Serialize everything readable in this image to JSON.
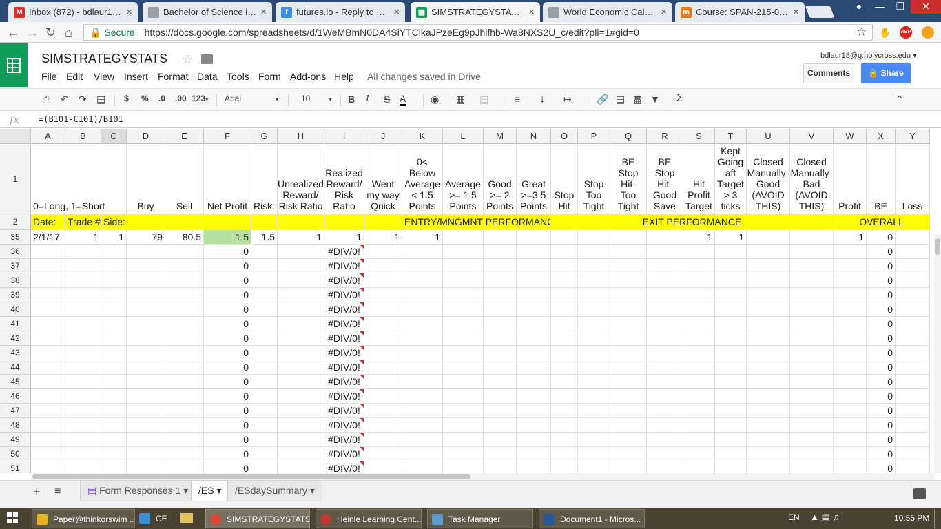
{
  "browser": {
    "tabs": [
      {
        "title": "Inbox (872) - bdlaur18@",
        "icon": "gmail-icon",
        "color": "#d93025",
        "glyph": "M"
      },
      {
        "title": "Bachelor of Science in Sp",
        "icon": "page-icon",
        "color": "#9aa0a6",
        "glyph": ""
      },
      {
        "title": "futures.io - Reply to Topi",
        "icon": "futures-icon",
        "color": "#3b8ed8",
        "glyph": "f"
      },
      {
        "title": "SIMSTRATEGYSTATS - Go",
        "icon": "sheets-icon",
        "color": "#0f9d58",
        "glyph": "▦"
      },
      {
        "title": "World Economic Calenda",
        "icon": "page-icon",
        "color": "#9aa0a6",
        "glyph": ""
      },
      {
        "title": "Course: SPAN-215-01.20",
        "icon": "course-icon",
        "color": "#e67c22",
        "glyph": "m"
      }
    ],
    "security_label": "Secure",
    "url": "https://docs.google.com/spreadsheets/d/1WeMBmN0DA4SiYTClkaJPzeEg9pJhlfhb-Wa8NXS2U_c/edit?pli=1#gid=0"
  },
  "sheets": {
    "title": "SIMSTRATEGYSTATS",
    "menus": [
      "File",
      "Edit",
      "View",
      "Insert",
      "Format",
      "Data",
      "Tools",
      "Form",
      "Add-ons",
      "Help"
    ],
    "save_status": "All changes saved in Drive",
    "account": "bdlaur18@g.holycross.edu",
    "comments_label": "Comments",
    "share_label": "Share",
    "toolbar": {
      "currency": "$",
      "percent": "%",
      "dec_less": ".0",
      "dec_more": ".00",
      "format_more": "123",
      "font": "Arial",
      "font_size": "10",
      "bold": "B",
      "italic": "I",
      "strike": "S",
      "textcolor": "A"
    },
    "formula": "=(B101-C101)/B101",
    "formula_label": "fx"
  },
  "grid": {
    "columns": [
      "A",
      "B",
      "C",
      "D",
      "E",
      "F",
      "G",
      "H",
      "I",
      "J",
      "K",
      "L",
      "M",
      "N",
      "O",
      "P",
      "Q",
      "R",
      "S",
      "T",
      "U",
      "V",
      "W",
      "X",
      "Y"
    ],
    "row1": [
      "0=Long, 1=Short",
      "",
      "",
      "Buy",
      "Sell",
      "Net Profit",
      "Risk:",
      "Unrealized Reward/ Risk Ratio",
      "Realized Reward/ Risk Ratio",
      "Went my way Quick",
      "0< Below Average < 1.5 Points",
      "Average >= 1.5 Points",
      "Good >= 2 Points",
      "Great >=3.5 Points",
      "Stop Hit",
      "Stop Too Tight",
      "BE Stop Hit- Too Tight",
      "BE Stop Hit- Good Save",
      "Hit Profit Target",
      "Kept Going aft Target > 3 ticks",
      "Closed Manually- Good (AVOID THIS)",
      "Closed Manually- Bad (AVOID THIS)",
      "Profit",
      "BE",
      "Loss"
    ],
    "row2": {
      "a": "Date:",
      "b": "Trade #",
      "c": "Side:",
      "entry": "ENTRY/MNGMNT PERFORMANCE",
      "exit": "EXIT PERFORMANCE",
      "overall": "OVERALL"
    },
    "row35": {
      "a": "2/1/17",
      "b": "1",
      "c": "1",
      "d": "79",
      "e": "80.5",
      "f": "1.5",
      "g": "1.5",
      "h": "1",
      "i": "1",
      "j": "1",
      "k": "1",
      "s": "1",
      "t": "1",
      "w": "1",
      "x": "0"
    },
    "rownums": [
      "1",
      "2",
      "35",
      "36",
      "37",
      "38",
      "39",
      "40",
      "41",
      "42",
      "43",
      "44",
      "45",
      "46",
      "47",
      "48",
      "49",
      "50",
      "51"
    ],
    "empty_f": "0",
    "empty_i": "#DIV/0!",
    "empty_x": "0"
  },
  "sheet_tabs": [
    "Form Responses 1",
    "/ES",
    "/ESdaySummary"
  ],
  "taskbar": {
    "items": [
      "Paper@thinkorswim ...",
      "CE 2",
      "SIMSTRATEGYSTATS...",
      "Heinle Learning Cent...",
      "Task Manager",
      "Document1 - Micros..."
    ],
    "lang": "EN",
    "clock": "10:55 PM"
  }
}
